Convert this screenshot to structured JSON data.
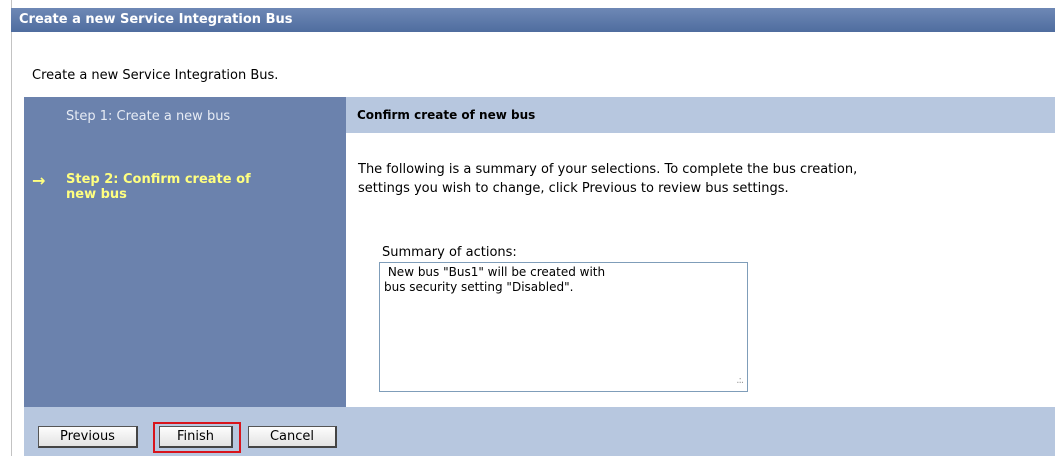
{
  "window": {
    "title": "Create a new Service Integration Bus"
  },
  "page": {
    "subtitle": "Create a new Service Integration Bus."
  },
  "steps": [
    {
      "label": "Step  1:  Create a new bus",
      "current": false
    },
    {
      "label": "Step 2: Confirm create of new bus",
      "current": true
    }
  ],
  "current_step_marker": "→",
  "content": {
    "header": "Confirm create of new bus",
    "description_line1": "The following is a summary of your selections. To complete the bus creation,",
    "description_line2": "settings you wish to change, click Previous to review bus settings.",
    "summary_label": "Summary of actions:",
    "summary_text": " New bus \"Bus1\" will be created with\nbus security setting \"Disabled\"."
  },
  "buttons": {
    "previous": "Previous",
    "finish": "Finish",
    "cancel": "Cancel"
  },
  "colors": {
    "titlebar": "#5d7aa8",
    "steps_panel": "#6b82ad",
    "current_step": "#ffff80",
    "header_band": "#b7c7df",
    "highlight": "#d8141c"
  }
}
